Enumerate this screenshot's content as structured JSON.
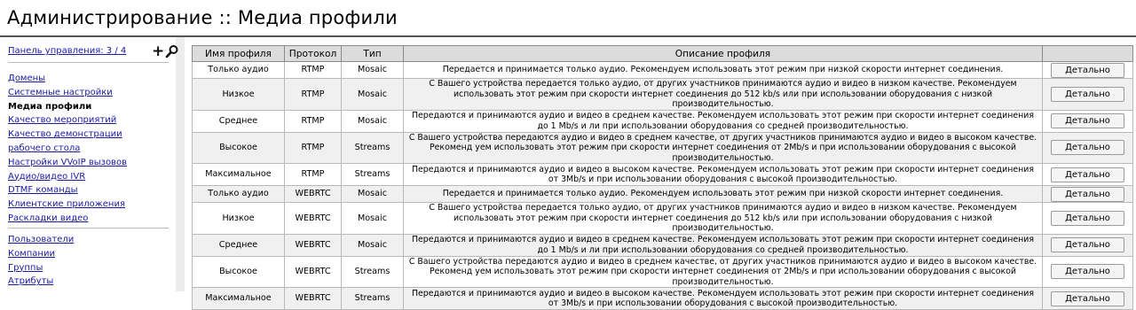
{
  "page": {
    "title": "Администрирование :: Медиа профили"
  },
  "sidebar": {
    "control_panel_label": "Панель управления: 3 / 4",
    "add_symbol": "+",
    "nav_group_1": [
      {
        "label": "Домены",
        "active": false
      },
      {
        "label": "Системные настройки",
        "active": false
      },
      {
        "label": "Медиа профили",
        "active": true
      },
      {
        "label": "Качество мероприятий",
        "active": false
      },
      {
        "label": "Качество демонстрации рабочего стола",
        "active": false
      },
      {
        "label": "Настройки VVoIP вызовов",
        "active": false
      },
      {
        "label": "Аудио/видео IVR",
        "active": false
      },
      {
        "label": "DTMF команды",
        "active": false
      },
      {
        "label": "Клиентские приложения",
        "active": false
      },
      {
        "label": "Раскладки видео",
        "active": false
      }
    ],
    "nav_group_2": [
      {
        "label": "Пользователи"
      },
      {
        "label": "Компании"
      },
      {
        "label": "Группы"
      },
      {
        "label": "Атрибуты"
      }
    ]
  },
  "table": {
    "headers": [
      "Имя профиля",
      "Протокол",
      "Тип",
      "Описание профиля",
      ""
    ],
    "button_label": "Детально",
    "rows": [
      {
        "name": "Только аудио",
        "protocol": "RTMP",
        "type": "Mosaic",
        "description": "Передается и принимается только аудио. Рекомендуем использовать этот режим при низкой скорости интернет соединения."
      },
      {
        "name": "Низкое",
        "protocol": "RTMP",
        "type": "Mosaic",
        "description": "С Вашего устройства передается только аудио, от других участников принимаются аудио и видео в низком качестве. Рекомендуем использовать этот режим при скорости интернет соединения до 512 kb/s или при использовании оборудования с низкой производительностью."
      },
      {
        "name": "Среднее",
        "protocol": "RTMP",
        "type": "Mosaic",
        "description": "Передаются и принимаются аудио и видео в среднем качестве. Рекомендуем использовать этот режим при скорости интернет соединения до 1 Mb/s и ли при использовании оборудования со средней производительностью."
      },
      {
        "name": "Высокое",
        "protocol": "RTMP",
        "type": "Streams",
        "description": "С Вашего устройства передаются аудио и видео в среднем качестве, от других участников принимаются аудио и видео в высоком качестве. Рекоменд уем использовать этот режим при скорости интернет соединения от 2Mb/s и при использовании оборудования с высокой производительностью."
      },
      {
        "name": "Максимальное",
        "protocol": "RTMP",
        "type": "Streams",
        "description": "Передаются и принимаются аудио и видео в высоком качестве. Рекомендуем использовать этот режим при скорости интернет соединения от 3Mb/s и при использовании оборудования с высокой производительностью."
      },
      {
        "name": "Только аудио",
        "protocol": "WEBRTC",
        "type": "Mosaic",
        "description": "Передается и принимается только аудио. Рекомендуем использовать этот режим при низкой скорости интернет соединения."
      },
      {
        "name": "Низкое",
        "protocol": "WEBRTC",
        "type": "Mosaic",
        "description": "С Вашего устройства передается только аудио, от других участников принимаются аудио и видео в низком качестве. Рекомендуем использовать этот режим при скорости интернет соединения до 512 kb/s или при использовании оборудования с низкой производительностью."
      },
      {
        "name": "Среднее",
        "protocol": "WEBRTC",
        "type": "Mosaic",
        "description": "Передаются и принимаются аудио и видео в среднем качестве. Рекомендуем использовать этот режим при скорости интернет соединения до 1 Mb/s и ли при использовании оборудования со средней производительностью."
      },
      {
        "name": "Высокое",
        "protocol": "WEBRTC",
        "type": "Streams",
        "description": "С Вашего устройства передаются аудио и видео в среднем качестве, от других участников принимаются аудио и видео в высоком качестве. Рекоменд уем использовать этот режим при скорости интернет соединения от 2Mb/s и при использовании оборудования с высокой производительностью."
      },
      {
        "name": "Максимальное",
        "protocol": "WEBRTC",
        "type": "Streams",
        "description": "Передаются и принимаются аудио и видео в высоком качестве. Рекомендуем использовать этот режим при скорости интернет соединения от 3Mb/s и при использовании оборудования с высокой производительностью."
      }
    ]
  }
}
